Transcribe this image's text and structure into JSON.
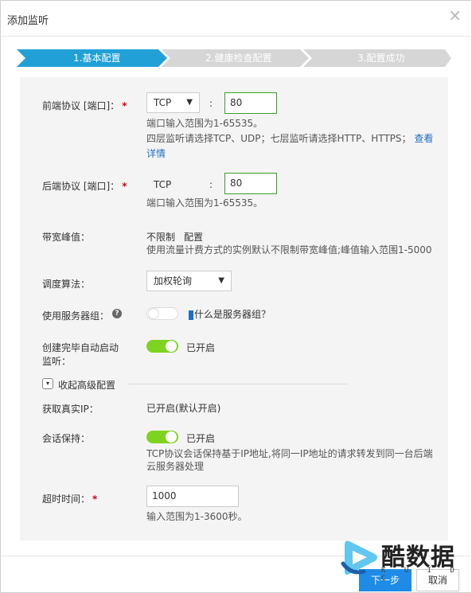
{
  "dialog": {
    "title": "添加监听",
    "close_glyph": "×"
  },
  "steps": [
    {
      "label": "1.基本配置",
      "active": true
    },
    {
      "label": "2.健康检查配置",
      "active": false
    },
    {
      "label": "3.配置成功",
      "active": false
    }
  ],
  "colors": {
    "step_active": "#21a0d8",
    "step_inactive": "#d6d6d6",
    "toggle_on": "#7ed321",
    "link": "#1e6fc3",
    "primary_button": "#1e8ce6",
    "required": "#d0021b"
  },
  "frontend": {
    "label": "前端协议 [端口]：",
    "required_mark": "*",
    "protocol_value": "TCP",
    "colon": ":",
    "port_value": "80",
    "hint1": "端口输入范围为1-65535。",
    "hint2": "四层监听请选择TCP、UDP；七层监听请选择HTTP、HTTPS；",
    "detail_link": "查看详情"
  },
  "backend": {
    "label": "后端协议 [端口]：",
    "required_mark": "*",
    "protocol_value": "TCP",
    "colon": ":",
    "port_value": "80",
    "hint": "端口输入范围为1-65535。"
  },
  "bandwidth": {
    "label": "带宽峰值：",
    "value": "不限制",
    "config_link": "配置",
    "hint": "使用流量计费方式的实例默认不限制带宽峰值;峰值输入范围1-5000"
  },
  "scheduler": {
    "label": "调度算法：",
    "value": "加权轮询"
  },
  "server_group": {
    "label": "使用服务器组：",
    "help_glyph": "?",
    "enabled": false,
    "link": "什么是服务器组？"
  },
  "auto_start": {
    "label_line1": "创建完毕自动启动",
    "label_line2": "监听：",
    "enabled": true,
    "status": "已开启"
  },
  "advanced": {
    "toggle_label": "收起高级配置"
  },
  "real_ip": {
    "label": "获取真实IP：",
    "value": "已开启(默认开启)"
  },
  "session": {
    "label": "会话保持：",
    "enabled": true,
    "status": "已开启",
    "hint_line1": "TCP协议会话保持基于IP地址,将同一IP地址的请求转发到同一台后端",
    "hint_line2": "云服务器处理"
  },
  "timeout": {
    "label": "超时时间：",
    "required_mark": "*",
    "value": "1000",
    "hint": "输入范围为1-3600秒。"
  },
  "footer": {
    "next_label": "下一步",
    "cancel_label": "取消"
  },
  "watermark": {
    "text": "酷数据",
    "sub": "K U I D C"
  }
}
